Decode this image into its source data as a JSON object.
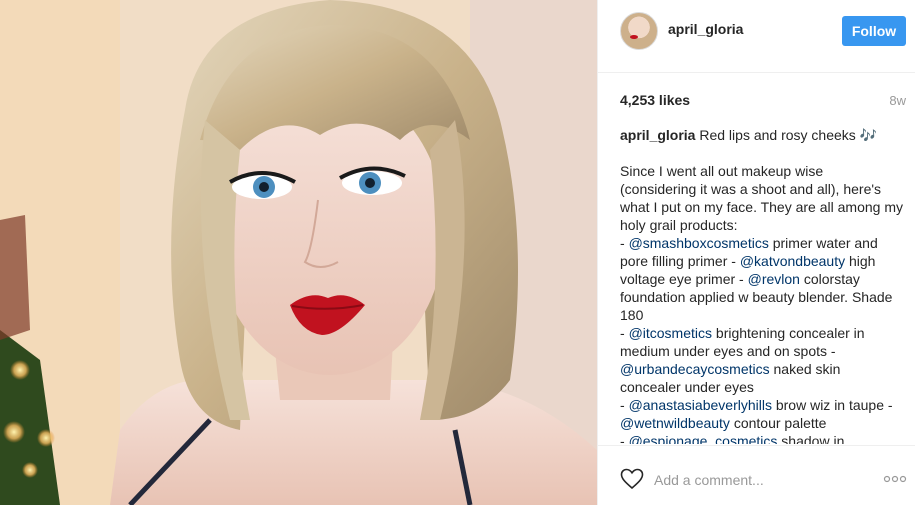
{
  "post": {
    "username": "april_gloria",
    "follow_label": "Follow",
    "likes": "4,253 likes",
    "age": "8w"
  },
  "caption": {
    "username": "april_gloria",
    "title": "Red lips and rosy cheeks 🎶",
    "p1": "Since I went all out makeup wise (considering it was a shoot and all), here's what I put on my face. They are all among my holy grail products:",
    "dash": "- ",
    "m1": "@smashboxcosmetics",
    "t1": " primer water and pore filling primer - ",
    "m2": "@katvondbeauty",
    "t2": " high voltage eye primer - ",
    "m3": "@revlon",
    "t3": " colorstay foundation applied w beauty blender. Shade 180",
    "m4": "@itcosmetics",
    "t4": " brightening concealer in medium under eyes and on spots -",
    "m5": "@urbandecaycosmetics",
    "t5": " naked skin concealer under eyes",
    "m6": "@anastasiabeverlyhills",
    "t6": " brow wiz in taupe - ",
    "m7": "@wetnwildbeauty",
    "t7": " contour palette",
    "m8": "@espionage_cosmetics",
    "t8": " shadow in"
  },
  "comment": {
    "placeholder": "Add a comment..."
  },
  "icons": {
    "like": "heart-outline-icon",
    "more": "more-options-icon"
  },
  "colors": {
    "follow": "#3897f0",
    "mention": "#003569",
    "text": "#262626",
    "muted": "#999999"
  }
}
